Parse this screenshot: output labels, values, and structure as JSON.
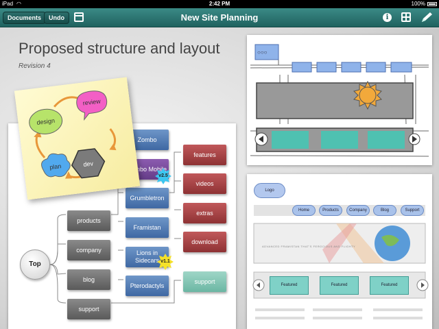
{
  "status_bar": {
    "carrier": "iPad",
    "time": "2:42 PM",
    "battery": "100%"
  },
  "toolbar": {
    "documents_label": "Documents",
    "undo_label": "Undo",
    "title": "New Site Planning"
  },
  "page": {
    "heading": "Proposed structure and layout",
    "subheading": "Revision 4"
  },
  "sitemap": {
    "top": "Top",
    "level1": [
      "products",
      "company",
      "blog",
      "support"
    ],
    "products": [
      "Zombo",
      "Zombo Mobile",
      "Grumbletron",
      "Framistan",
      "Lions in Sidecars",
      "Pterodactyls"
    ],
    "features": [
      "features",
      "videos",
      "extras",
      "download"
    ],
    "support_child": "support",
    "badges": [
      "v2.5",
      "v1.1"
    ]
  },
  "sticky": {
    "steps": [
      "design",
      "review",
      "dev",
      "plan"
    ]
  },
  "wireframe_2": {
    "logo": "Logo",
    "nav": [
      "Home",
      "Products",
      "Company",
      "Blog",
      "Support"
    ],
    "hero_text": "ADVANCED FRAMISTAN THAT'S FEROCIOUS AND FLIGHTY",
    "featured": [
      "Featured",
      "Featured",
      "Featured"
    ]
  },
  "colors": {
    "toolbar": "#2b7572",
    "product_node": "#4f78b3",
    "feature_node": "#a84346",
    "category_node": "#6a6a6a",
    "support_node": "#87c6b6"
  }
}
